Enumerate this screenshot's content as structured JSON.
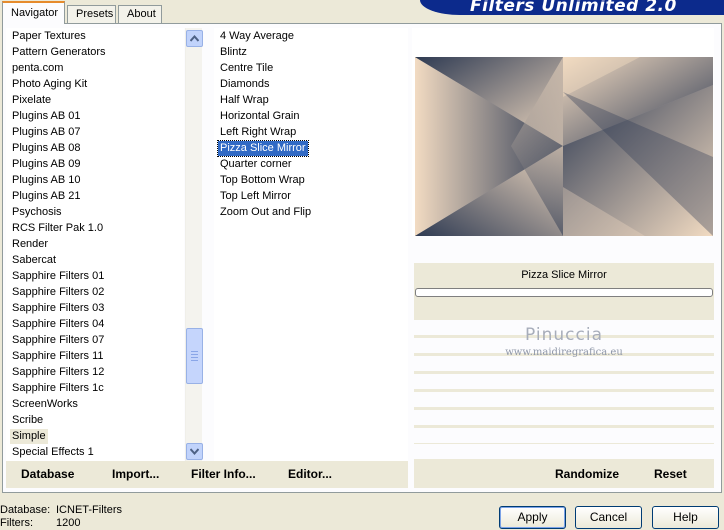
{
  "tabs": [
    "Navigator",
    "Presets",
    "About"
  ],
  "brand": "Filters Unlimited 2.0",
  "categories": [
    "Paper Textures",
    "Pattern Generators",
    "penta.com",
    "Photo Aging Kit",
    "Pixelate",
    "Plugins AB 01",
    "Plugins AB 07",
    "Plugins AB 08",
    "Plugins AB 09",
    "Plugins AB 10",
    "Plugins AB 21",
    "Psychosis",
    "RCS Filter Pak 1.0",
    "Render",
    "Sabercat",
    "Sapphire Filters 01",
    "Sapphire Filters 02",
    "Sapphire Filters 03",
    "Sapphire Filters 04",
    "Sapphire Filters 07",
    "Sapphire Filters 11",
    "Sapphire Filters 12",
    "Sapphire Filters 1c",
    "ScreenWorks",
    "Scribe",
    "Simple",
    "Special Effects 1"
  ],
  "selected_category": "Simple",
  "filters": [
    "4 Way Average",
    "Blintz",
    "Centre Tile",
    "Diamonds",
    "Half Wrap",
    "Horizontal Grain",
    "Left Right Wrap",
    "Pizza Slice Mirror",
    "Quarter corner",
    "Top Bottom Wrap",
    "Top Left Mirror",
    "Zoom Out and Flip"
  ],
  "selected_filter": "Pizza Slice Mirror",
  "left_bar": {
    "database": "Database",
    "import": "Import...",
    "filter_info": "Filter Info...",
    "editor": "Editor..."
  },
  "right_bar": {
    "randomize": "Randomize",
    "reset": "Reset"
  },
  "current_filter_label": "Pizza Slice Mirror",
  "watermark": {
    "name": "Pinuccia",
    "url": "www.maidiregrafica.eu"
  },
  "status": {
    "database_label": "Database:",
    "database_value": "ICNET-Filters",
    "filters_label": "Filters:",
    "filters_value": "1200"
  },
  "buttons": {
    "apply": "Apply",
    "cancel": "Cancel",
    "help": "Help"
  },
  "colors": {
    "selection": "#316ac5",
    "preview_dark": "#2e3a52",
    "preview_light": "#f2dbc2",
    "brand": "#0c2a8c"
  },
  "icons": {
    "scroll_up": "chevron-up-icon",
    "scroll_down": "chevron-down-icon"
  }
}
